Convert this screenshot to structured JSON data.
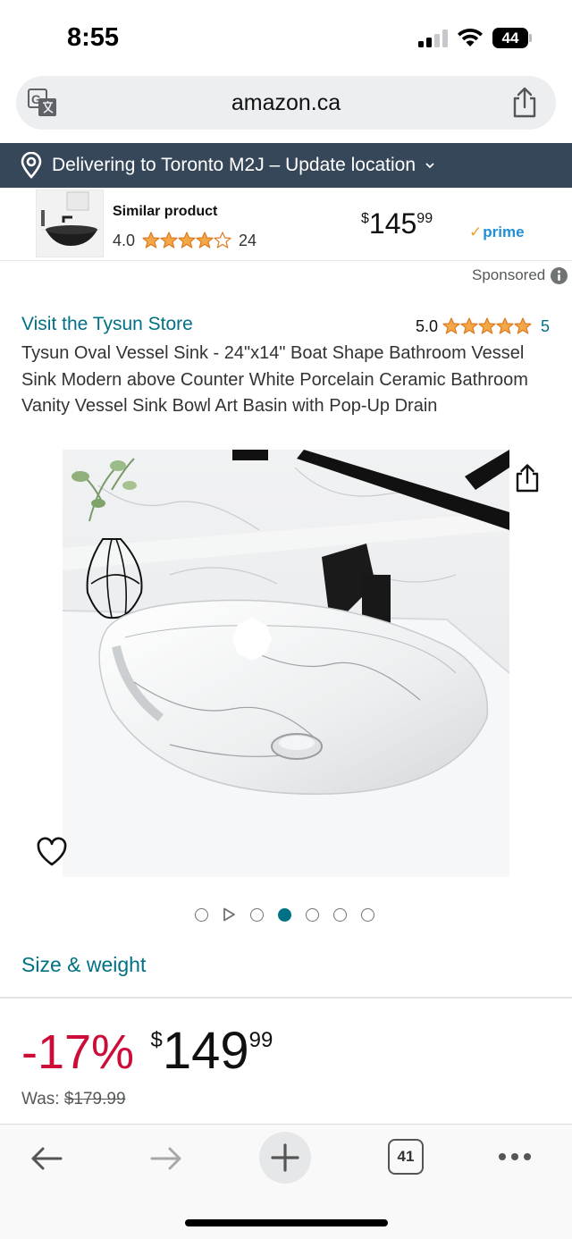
{
  "status_bar": {
    "time": "8:55",
    "battery_level": "44"
  },
  "browser": {
    "url": "amazon.ca",
    "tab_count": "41"
  },
  "delivery": {
    "text": "Delivering to Toronto M2J – Update location"
  },
  "similar_product": {
    "title": "Similar product",
    "rating": "4.0",
    "rating_value": 4.0,
    "review_count": "24",
    "price_symbol": "$",
    "price_whole": "145",
    "price_cents": "99",
    "prime_label": "prime"
  },
  "sponsored_label": "Sponsored",
  "product": {
    "store_link": "Visit the Tysun Store",
    "rating": "5.0",
    "rating_value": 5.0,
    "review_count": "5",
    "title": "Tysun Oval Vessel Sink - 24\"x14\" Boat Shape Bathroom Vessel Sink Modern above Counter White Porcelain Ceramic Bathroom Vanity Vessel Sink Bowl Art Basin with Pop-Up Drain",
    "image_count": 6,
    "active_image_index": 2,
    "size_weight_link": "Size & weight",
    "discount": "-17%",
    "price_symbol": "$",
    "price_whole": "149",
    "price_cents": "99",
    "was_label": "Was:",
    "was_price": "$179.99"
  },
  "colors": {
    "delivery_bar": "#37475a",
    "link": "#007185",
    "discount": "#cc0c39",
    "star": "#f3a847",
    "prime": "#1f8fd6"
  },
  "icons": {
    "translate": "translate-icon",
    "share": "share-icon",
    "location": "location-pin-icon",
    "info": "info-icon",
    "heart": "heart-icon",
    "back": "back-arrow-icon",
    "forward": "forward-arrow-icon",
    "new_tab": "plus-icon",
    "more": "more-dots-icon"
  }
}
